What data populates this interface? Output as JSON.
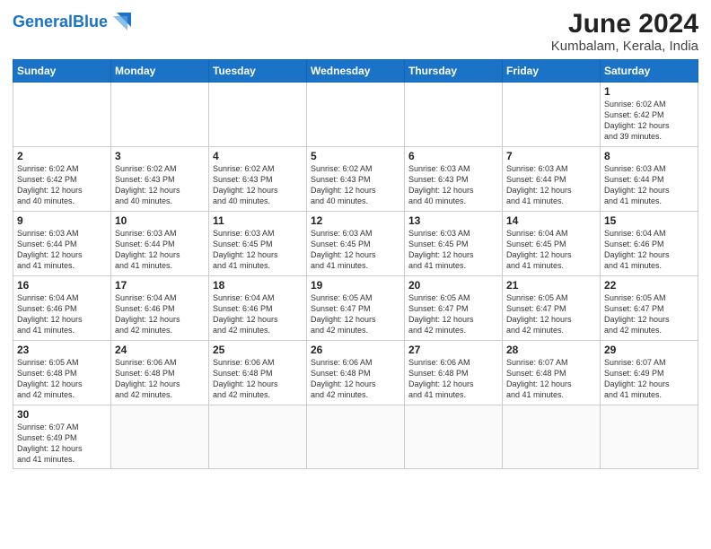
{
  "header": {
    "logo_general": "General",
    "logo_blue": "Blue",
    "title": "June 2024",
    "subtitle": "Kumbalam, Kerala, India"
  },
  "weekdays": [
    "Sunday",
    "Monday",
    "Tuesday",
    "Wednesday",
    "Thursday",
    "Friday",
    "Saturday"
  ],
  "weeks": [
    [
      {
        "day": "",
        "info": ""
      },
      {
        "day": "",
        "info": ""
      },
      {
        "day": "",
        "info": ""
      },
      {
        "day": "",
        "info": ""
      },
      {
        "day": "",
        "info": ""
      },
      {
        "day": "",
        "info": ""
      },
      {
        "day": "1",
        "info": "Sunrise: 6:02 AM\nSunset: 6:42 PM\nDaylight: 12 hours\nand 39 minutes."
      }
    ],
    [
      {
        "day": "2",
        "info": "Sunrise: 6:02 AM\nSunset: 6:42 PM\nDaylight: 12 hours\nand 40 minutes."
      },
      {
        "day": "3",
        "info": "Sunrise: 6:02 AM\nSunset: 6:43 PM\nDaylight: 12 hours\nand 40 minutes."
      },
      {
        "day": "4",
        "info": "Sunrise: 6:02 AM\nSunset: 6:43 PM\nDaylight: 12 hours\nand 40 minutes."
      },
      {
        "day": "5",
        "info": "Sunrise: 6:02 AM\nSunset: 6:43 PM\nDaylight: 12 hours\nand 40 minutes."
      },
      {
        "day": "6",
        "info": "Sunrise: 6:03 AM\nSunset: 6:43 PM\nDaylight: 12 hours\nand 40 minutes."
      },
      {
        "day": "7",
        "info": "Sunrise: 6:03 AM\nSunset: 6:44 PM\nDaylight: 12 hours\nand 41 minutes."
      },
      {
        "day": "8",
        "info": "Sunrise: 6:03 AM\nSunset: 6:44 PM\nDaylight: 12 hours\nand 41 minutes."
      }
    ],
    [
      {
        "day": "9",
        "info": "Sunrise: 6:03 AM\nSunset: 6:44 PM\nDaylight: 12 hours\nand 41 minutes."
      },
      {
        "day": "10",
        "info": "Sunrise: 6:03 AM\nSunset: 6:44 PM\nDaylight: 12 hours\nand 41 minutes."
      },
      {
        "day": "11",
        "info": "Sunrise: 6:03 AM\nSunset: 6:45 PM\nDaylight: 12 hours\nand 41 minutes."
      },
      {
        "day": "12",
        "info": "Sunrise: 6:03 AM\nSunset: 6:45 PM\nDaylight: 12 hours\nand 41 minutes."
      },
      {
        "day": "13",
        "info": "Sunrise: 6:03 AM\nSunset: 6:45 PM\nDaylight: 12 hours\nand 41 minutes."
      },
      {
        "day": "14",
        "info": "Sunrise: 6:04 AM\nSunset: 6:45 PM\nDaylight: 12 hours\nand 41 minutes."
      },
      {
        "day": "15",
        "info": "Sunrise: 6:04 AM\nSunset: 6:46 PM\nDaylight: 12 hours\nand 41 minutes."
      }
    ],
    [
      {
        "day": "16",
        "info": "Sunrise: 6:04 AM\nSunset: 6:46 PM\nDaylight: 12 hours\nand 41 minutes."
      },
      {
        "day": "17",
        "info": "Sunrise: 6:04 AM\nSunset: 6:46 PM\nDaylight: 12 hours\nand 42 minutes."
      },
      {
        "day": "18",
        "info": "Sunrise: 6:04 AM\nSunset: 6:46 PM\nDaylight: 12 hours\nand 42 minutes."
      },
      {
        "day": "19",
        "info": "Sunrise: 6:05 AM\nSunset: 6:47 PM\nDaylight: 12 hours\nand 42 minutes."
      },
      {
        "day": "20",
        "info": "Sunrise: 6:05 AM\nSunset: 6:47 PM\nDaylight: 12 hours\nand 42 minutes."
      },
      {
        "day": "21",
        "info": "Sunrise: 6:05 AM\nSunset: 6:47 PM\nDaylight: 12 hours\nand 42 minutes."
      },
      {
        "day": "22",
        "info": "Sunrise: 6:05 AM\nSunset: 6:47 PM\nDaylight: 12 hours\nand 42 minutes."
      }
    ],
    [
      {
        "day": "23",
        "info": "Sunrise: 6:05 AM\nSunset: 6:48 PM\nDaylight: 12 hours\nand 42 minutes."
      },
      {
        "day": "24",
        "info": "Sunrise: 6:06 AM\nSunset: 6:48 PM\nDaylight: 12 hours\nand 42 minutes."
      },
      {
        "day": "25",
        "info": "Sunrise: 6:06 AM\nSunset: 6:48 PM\nDaylight: 12 hours\nand 42 minutes."
      },
      {
        "day": "26",
        "info": "Sunrise: 6:06 AM\nSunset: 6:48 PM\nDaylight: 12 hours\nand 42 minutes."
      },
      {
        "day": "27",
        "info": "Sunrise: 6:06 AM\nSunset: 6:48 PM\nDaylight: 12 hours\nand 41 minutes."
      },
      {
        "day": "28",
        "info": "Sunrise: 6:07 AM\nSunset: 6:48 PM\nDaylight: 12 hours\nand 41 minutes."
      },
      {
        "day": "29",
        "info": "Sunrise: 6:07 AM\nSunset: 6:49 PM\nDaylight: 12 hours\nand 41 minutes."
      }
    ],
    [
      {
        "day": "30",
        "info": "Sunrise: 6:07 AM\nSunset: 6:49 PM\nDaylight: 12 hours\nand 41 minutes."
      },
      {
        "day": "",
        "info": ""
      },
      {
        "day": "",
        "info": ""
      },
      {
        "day": "",
        "info": ""
      },
      {
        "day": "",
        "info": ""
      },
      {
        "day": "",
        "info": ""
      },
      {
        "day": "",
        "info": ""
      }
    ]
  ]
}
